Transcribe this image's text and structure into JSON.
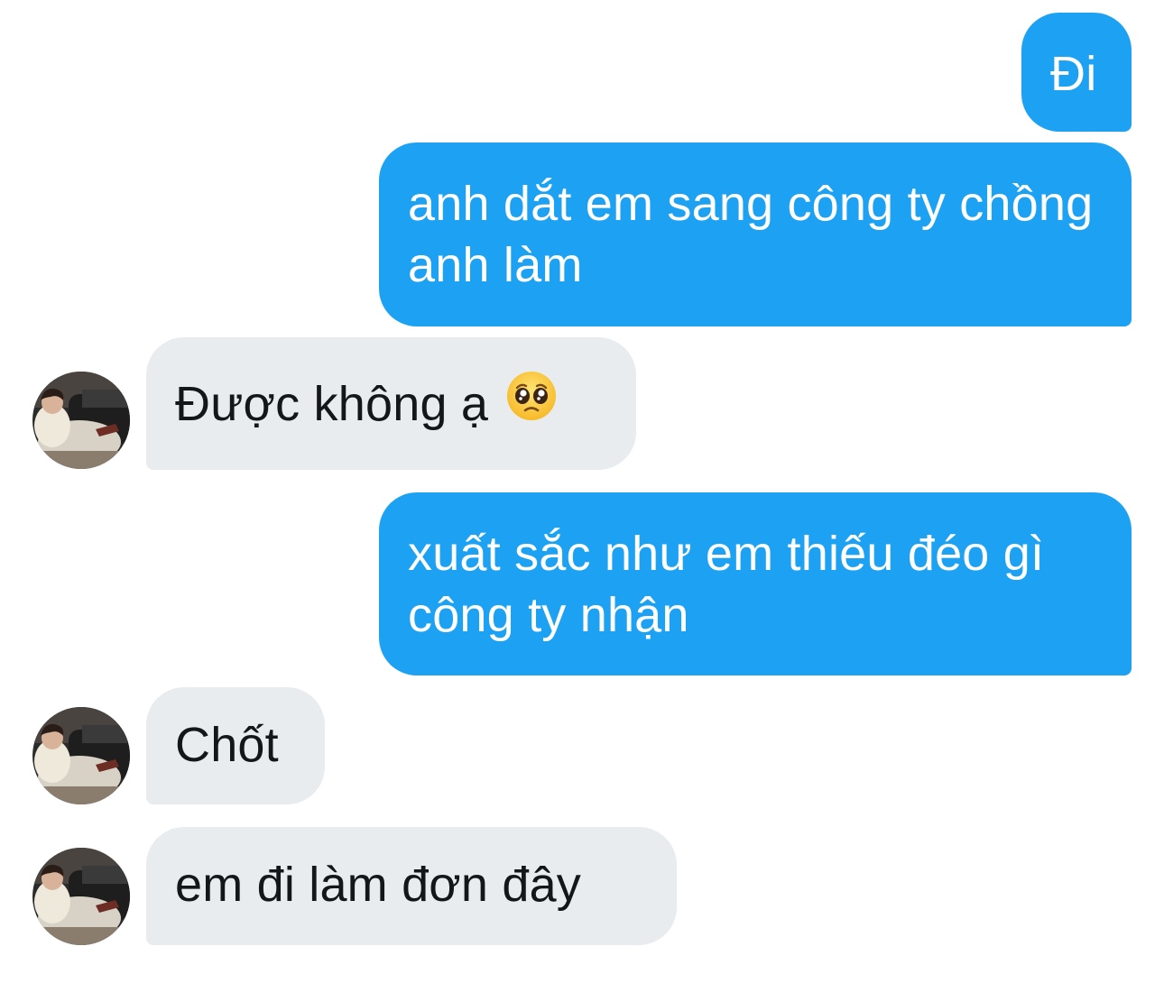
{
  "messages": [
    {
      "from": "me",
      "text": "Đi"
    },
    {
      "from": "me",
      "text": "anh dắt em sang công ty chồng anh làm"
    },
    {
      "from": "them",
      "text": "Được không ạ",
      "emoji": "pleading-face-emoji"
    },
    {
      "from": "me",
      "text": "xuất sắc như em thiếu đéo gì công ty nhận"
    },
    {
      "from": "them",
      "text": "Chốt"
    },
    {
      "from": "them",
      "text": "em đi làm đơn đây"
    }
  ],
  "colors": {
    "outgoing_bubble": "#1da1f2",
    "incoming_bubble": "#e8ecef",
    "incoming_text": "#14171a",
    "outgoing_text": "#ffffff"
  },
  "icons": {
    "avatar": "user-avatar-photo",
    "emoji": "pleading-face-emoji"
  }
}
